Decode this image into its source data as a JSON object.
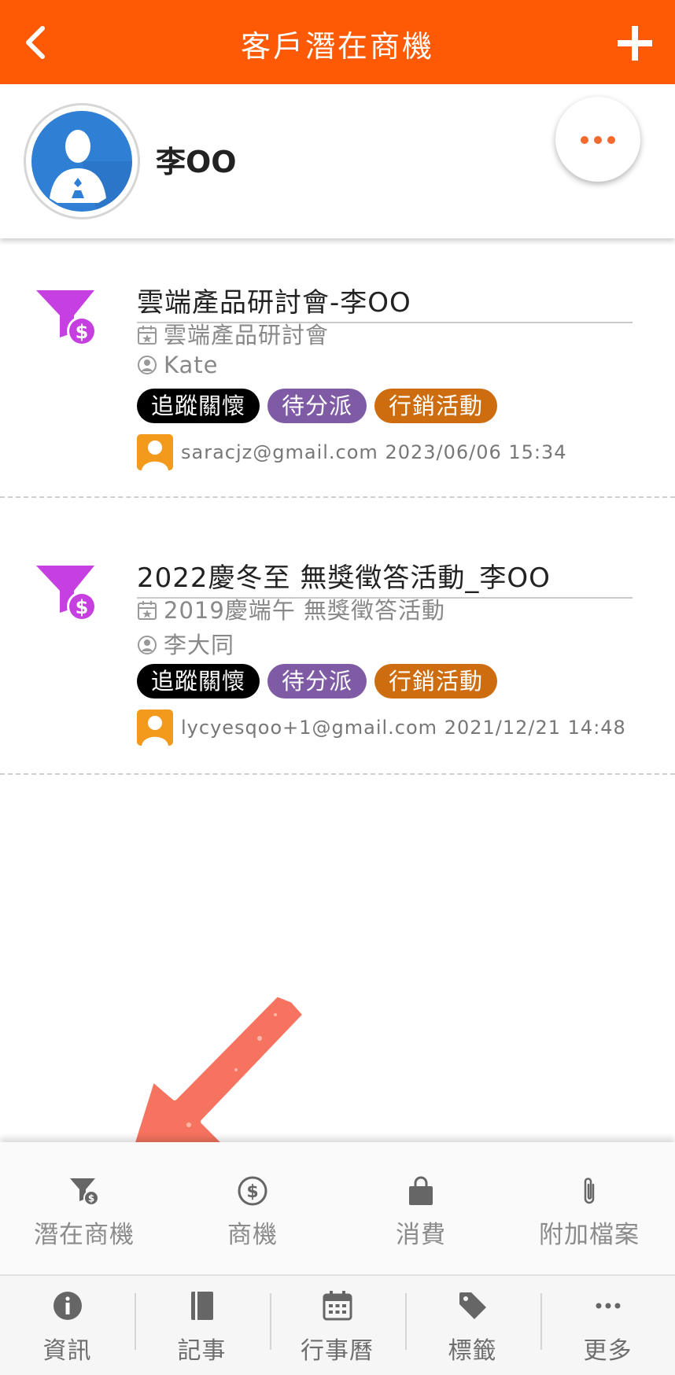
{
  "header": {
    "title": "客戶潛在商機"
  },
  "customer": {
    "name": "李OO"
  },
  "leads": [
    {
      "title": "雲端產品研討會-李OO",
      "campaign": "雲端產品研討會",
      "owner": "Kate",
      "tags": [
        "追蹤關懷",
        "待分派",
        "行銷活動"
      ],
      "creator_email": "saracjz@gmail.com",
      "timestamp": "2023/06/06 15:34"
    },
    {
      "title": "2022慶冬至 無獎徵答活動_李OO",
      "campaign": "2019慶端午 無獎徵答活動",
      "owner": "李大同",
      "tags": [
        "追蹤關懷",
        "待分派",
        "行銷活動"
      ],
      "creator_email": "lycyesqoo+1@gmail.com",
      "timestamp": "2021/12/21 14:48"
    }
  ],
  "sub_tabs": [
    {
      "label": "潛在商機",
      "icon": "funnel-dollar-icon"
    },
    {
      "label": "商機",
      "icon": "dollar-circle-icon"
    },
    {
      "label": "消費",
      "icon": "shopping-bag-icon"
    },
    {
      "label": "附加檔案",
      "icon": "paperclip-icon"
    }
  ],
  "bottom_nav": [
    {
      "label": "資訊",
      "icon": "info-icon"
    },
    {
      "label": "記事",
      "icon": "notebook-icon"
    },
    {
      "label": "行事曆",
      "icon": "calendar-icon"
    },
    {
      "label": "標籤",
      "icon": "tag-icon"
    },
    {
      "label": "更多",
      "icon": "more-dots-icon"
    }
  ],
  "colors": {
    "brand_orange": "#fe5a05",
    "funnel_purple": "#c63fe0",
    "tag_black": "#000000",
    "tag_purple": "#7f5aa5",
    "tag_brown": "#cd6d0f",
    "arrow_annotation": "#f5735f"
  }
}
